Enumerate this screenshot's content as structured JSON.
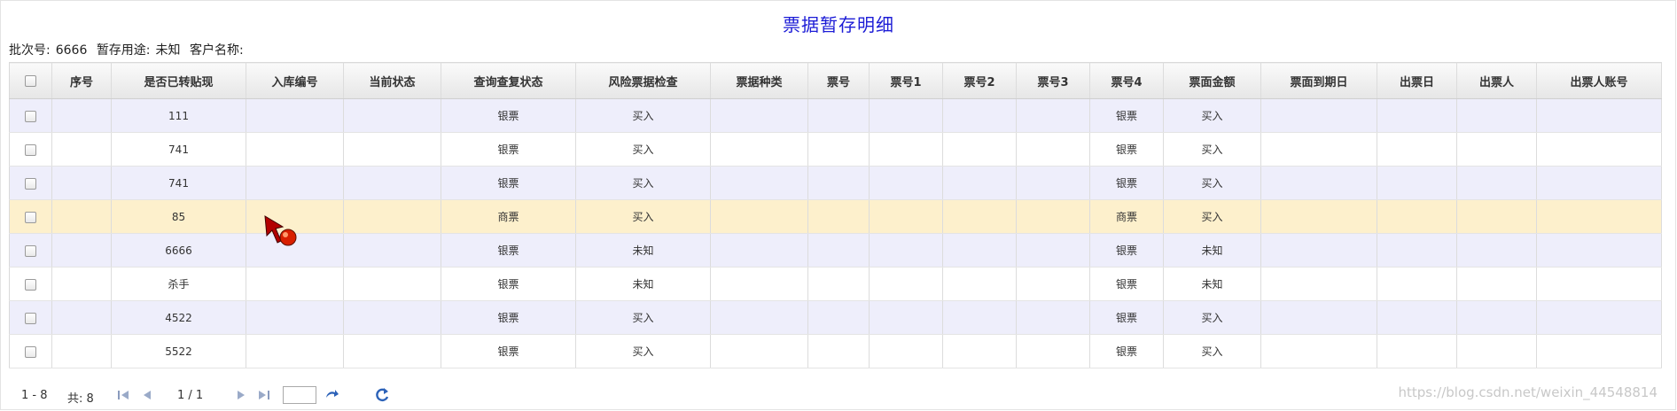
{
  "page": {
    "title": "票据暂存明细",
    "batch_label": "批次号:",
    "batch_value": "6666",
    "purpose_label": "暂存用途:",
    "purpose_value": "未知",
    "customer_label": "客户名称:"
  },
  "table": {
    "columns": [
      "序号",
      "是否已转贴现",
      "入库编号",
      "当前状态",
      "查询查复状态",
      "风险票据检查",
      "票据种类",
      "票号",
      "票号1",
      "票号2",
      "票号3",
      "票号4",
      "票面金额",
      "票面到期日",
      "出票日",
      "出票人",
      "出票人账号"
    ],
    "rows": [
      {
        "c1": "111",
        "c4": "银票",
        "c5": "买入",
        "c11": "银票",
        "c12": "买入"
      },
      {
        "c1": "741",
        "c4": "银票",
        "c5": "买入",
        "c11": "银票",
        "c12": "买入"
      },
      {
        "c1": "741",
        "c4": "银票",
        "c5": "买入",
        "c11": "银票",
        "c12": "买入"
      },
      {
        "c1": "85",
        "c4": "商票",
        "c5": "买入",
        "c11": "商票",
        "c12": "买入"
      },
      {
        "c1": "6666",
        "c4": "银票",
        "c5": "未知",
        "c11": "银票",
        "c12": "未知"
      },
      {
        "c1": "杀手",
        "c4": "银票",
        "c5": "未知",
        "c11": "银票",
        "c12": "未知"
      },
      {
        "c1": "4522",
        "c4": "银票",
        "c5": "买入",
        "c11": "银票",
        "c12": "买入"
      },
      {
        "c1": "5522",
        "c4": "银票",
        "c5": "买入",
        "c11": "银票",
        "c12": "买入"
      }
    ]
  },
  "pager": {
    "range": "1 - 8",
    "total": "共: 8",
    "page": "1 / 1",
    "page_input": ""
  },
  "watermark": "https://blog.csdn.net/weixin_44548814"
}
